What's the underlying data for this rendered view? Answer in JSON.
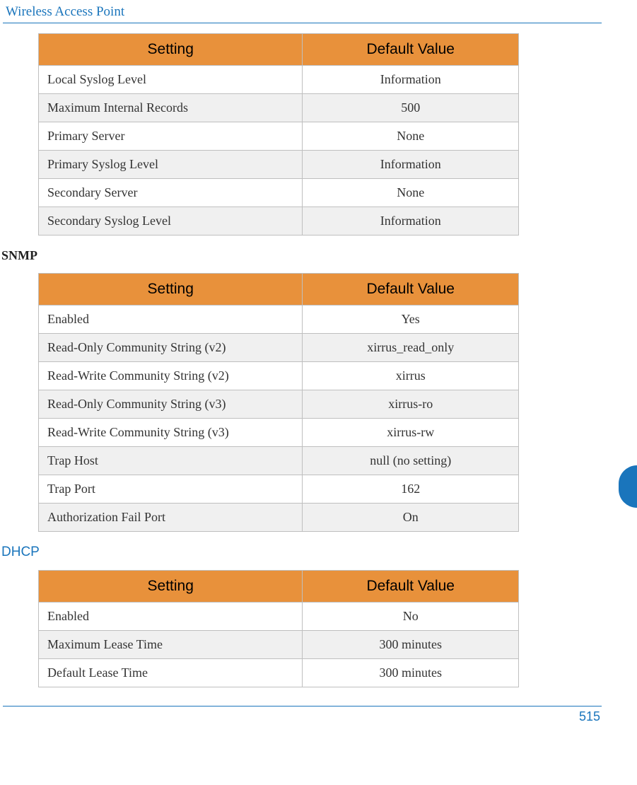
{
  "page_title": "Wireless Access Point",
  "page_number": "515",
  "columns": {
    "setting": "Setting",
    "value": "Default Value"
  },
  "tables": [
    {
      "heading": null,
      "rows": [
        {
          "setting": "Local Syslog Level",
          "value": "Information"
        },
        {
          "setting": "Maximum Internal Records",
          "value": "500"
        },
        {
          "setting": "Primary Server",
          "value": "None"
        },
        {
          "setting": "Primary Syslog Level",
          "value": "Information"
        },
        {
          "setting": "Secondary Server",
          "value": "None"
        },
        {
          "setting": "Secondary Syslog Level",
          "value": "Information"
        }
      ]
    },
    {
      "heading": "SNMP",
      "heading_style": "bold",
      "rows": [
        {
          "setting": "Enabled",
          "value": "Yes"
        },
        {
          "setting": "Read-Only Community String (v2)",
          "value": "xirrus_read_only"
        },
        {
          "setting": "Read-Write Community String (v2)",
          "value": "xirrus"
        },
        {
          "setting": "Read-Only Community String (v3)",
          "value": "xirrus-ro"
        },
        {
          "setting": "Read-Write Community String (v3)",
          "value": "xirrus-rw"
        },
        {
          "setting": "Trap Host",
          "value": "null (no setting)"
        },
        {
          "setting": "Trap Port",
          "value": "162"
        },
        {
          "setting": "Authorization Fail Port",
          "value": "On"
        }
      ]
    },
    {
      "heading": "DHCP",
      "heading_style": "blue",
      "rows": [
        {
          "setting": "Enabled",
          "value": "No"
        },
        {
          "setting": "Maximum Lease Time",
          "value": "300 minutes"
        },
        {
          "setting": "Default Lease Time",
          "value": "300 minutes"
        }
      ]
    }
  ]
}
